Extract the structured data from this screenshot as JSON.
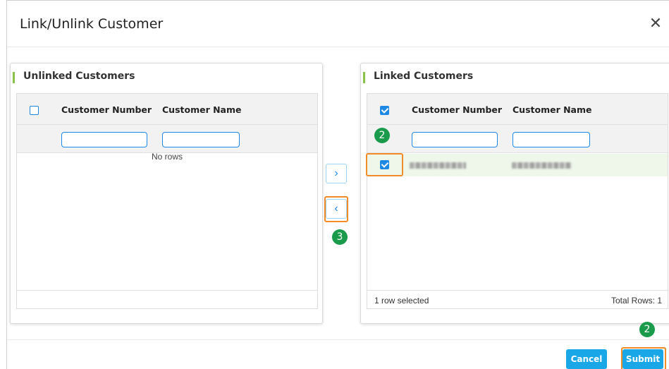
{
  "dialog": {
    "title": "Link/Unlink Customer",
    "close_icon": "close-icon",
    "close_glyph": "✕"
  },
  "unlinked": {
    "title": "Unlinked Customers",
    "columns": [
      "Customer Number",
      "Customer Name"
    ],
    "filters": {
      "customer_number": "",
      "customer_name": ""
    },
    "empty_text": "No rows",
    "rows": []
  },
  "linked": {
    "title": "Linked Customers",
    "columns": [
      "Customer Number",
      "Customer Name"
    ],
    "filters": {
      "customer_number": "",
      "customer_name": ""
    },
    "header_checked": true,
    "rows": [
      {
        "selected": true,
        "customer_number": "",
        "customer_name": ""
      }
    ],
    "footer": {
      "selected_text": "1 row selected",
      "total_text": "Total Rows: 1"
    }
  },
  "move": {
    "link_glyph": "›",
    "unlink_glyph": "‹",
    "link_icon": "chevron-right-icon",
    "unlink_icon": "chevron-left-icon"
  },
  "annotations": {
    "step_header": "2",
    "step_unlink": "3",
    "step_submit": "2",
    "highlight_color": "#f28c28",
    "badge_color": "#1a9b4b"
  },
  "actions": {
    "cancel_label": "Cancel",
    "submit_label": "Submit"
  },
  "colors": {
    "accent": "#1e88e5",
    "button": "#1aa7e8",
    "panel_accent": "#8bc34a",
    "selected_row": "#eef7ea"
  }
}
